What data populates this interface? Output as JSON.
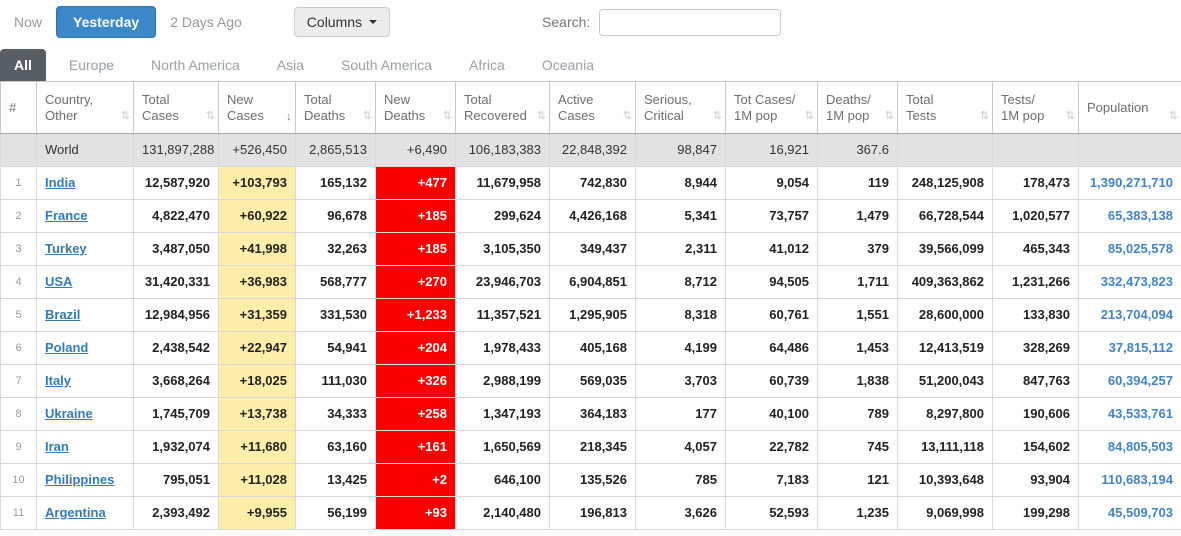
{
  "toolbar": {
    "now_label": "Now",
    "yesterday_label": "Yesterday",
    "two_days_ago_label": "2 Days Ago",
    "columns_label": "Columns",
    "search_label": "Search:",
    "search_value": ""
  },
  "colors": {
    "active_button_blue": "#3b87c8",
    "active_tab_gray": "#565d63",
    "new_cases_yellow": "#FFEEAA",
    "new_deaths_red": "#fa0000",
    "world_row_gray": "#e2e2e2",
    "link_blue": "#337ab7"
  },
  "icons": {
    "sort_both": "⇅",
    "sort_desc": "↓",
    "caret_down": "▾"
  },
  "tabs": [
    {
      "label": "All",
      "state": "active"
    },
    {
      "label": "Europe",
      "state": ""
    },
    {
      "label": "North America",
      "state": ""
    },
    {
      "label": "Asia",
      "state": ""
    },
    {
      "label": "South America",
      "state": ""
    },
    {
      "label": "Africa",
      "state": ""
    },
    {
      "label": "Oceania",
      "state": ""
    }
  ],
  "table": {
    "columns": [
      {
        "line1": "#",
        "line2": "",
        "sort": "none",
        "sort_icon": ""
      },
      {
        "line1": "Country,",
        "line2": "Other",
        "sort": "both",
        "sort_icon": "⇅"
      },
      {
        "line1": "Total",
        "line2": "Cases",
        "sort": "both",
        "sort_icon": "⇅"
      },
      {
        "line1": "New",
        "line2": "Cases",
        "sort": "desc",
        "sort_icon": "↓"
      },
      {
        "line1": "Total",
        "line2": "Deaths",
        "sort": "both",
        "sort_icon": "⇅"
      },
      {
        "line1": "New",
        "line2": "Deaths",
        "sort": "both",
        "sort_icon": "⇅"
      },
      {
        "line1": "Total",
        "line2": "Recovered",
        "sort": "both",
        "sort_icon": "⇅"
      },
      {
        "line1": "Active",
        "line2": "Cases",
        "sort": "both",
        "sort_icon": "⇅"
      },
      {
        "line1": "Serious,",
        "line2": "Critical",
        "sort": "both",
        "sort_icon": "⇅"
      },
      {
        "line1": "Tot Cases/",
        "line2": "1M pop",
        "sort": "both",
        "sort_icon": "⇅"
      },
      {
        "line1": "Deaths/",
        "line2": "1M pop",
        "sort": "both",
        "sort_icon": "⇅"
      },
      {
        "line1": "Total",
        "line2": "Tests",
        "sort": "both",
        "sort_icon": "⇅"
      },
      {
        "line1": "Tests/",
        "line2": "1M pop",
        "sort": "both",
        "sort_icon": "⇅"
      },
      {
        "line1": "Population",
        "line2": "",
        "sort": "both",
        "sort_icon": "⇅"
      }
    ],
    "world": {
      "name": "World",
      "total_cases": "131,897,288",
      "new_cases": "+526,450",
      "total_deaths": "2,865,513",
      "new_deaths": "+6,490",
      "total_recovered": "106,183,383",
      "active_cases": "22,848,392",
      "serious_critical": "98,847",
      "cases_per_1m": "16,921",
      "deaths_per_1m": "367.6",
      "total_tests": "",
      "tests_per_1m": "",
      "population": ""
    },
    "rows": [
      {
        "rank": "1",
        "country": "India",
        "total_cases": "12,587,920",
        "new_cases": "+103,793",
        "total_deaths": "165,132",
        "new_deaths": "+477",
        "total_recovered": "11,679,958",
        "active_cases": "742,830",
        "serious_critical": "8,944",
        "cases_per_1m": "9,054",
        "deaths_per_1m": "119",
        "total_tests": "248,125,908",
        "tests_per_1m": "178,473",
        "population": "1,390,271,710"
      },
      {
        "rank": "2",
        "country": "France",
        "total_cases": "4,822,470",
        "new_cases": "+60,922",
        "total_deaths": "96,678",
        "new_deaths": "+185",
        "total_recovered": "299,624",
        "active_cases": "4,426,168",
        "serious_critical": "5,341",
        "cases_per_1m": "73,757",
        "deaths_per_1m": "1,479",
        "total_tests": "66,728,544",
        "tests_per_1m": "1,020,577",
        "population": "65,383,138"
      },
      {
        "rank": "3",
        "country": "Turkey",
        "total_cases": "3,487,050",
        "new_cases": "+41,998",
        "total_deaths": "32,263",
        "new_deaths": "+185",
        "total_recovered": "3,105,350",
        "active_cases": "349,437",
        "serious_critical": "2,311",
        "cases_per_1m": "41,012",
        "deaths_per_1m": "379",
        "total_tests": "39,566,099",
        "tests_per_1m": "465,343",
        "population": "85,025,578"
      },
      {
        "rank": "4",
        "country": "USA",
        "total_cases": "31,420,331",
        "new_cases": "+36,983",
        "total_deaths": "568,777",
        "new_deaths": "+270",
        "total_recovered": "23,946,703",
        "active_cases": "6,904,851",
        "serious_critical": "8,712",
        "cases_per_1m": "94,505",
        "deaths_per_1m": "1,711",
        "total_tests": "409,363,862",
        "tests_per_1m": "1,231,266",
        "population": "332,473,823"
      },
      {
        "rank": "5",
        "country": "Brazil",
        "total_cases": "12,984,956",
        "new_cases": "+31,359",
        "total_deaths": "331,530",
        "new_deaths": "+1,233",
        "total_recovered": "11,357,521",
        "active_cases": "1,295,905",
        "serious_critical": "8,318",
        "cases_per_1m": "60,761",
        "deaths_per_1m": "1,551",
        "total_tests": "28,600,000",
        "tests_per_1m": "133,830",
        "population": "213,704,094"
      },
      {
        "rank": "6",
        "country": "Poland",
        "total_cases": "2,438,542",
        "new_cases": "+22,947",
        "total_deaths": "54,941",
        "new_deaths": "+204",
        "total_recovered": "1,978,433",
        "active_cases": "405,168",
        "serious_critical": "4,199",
        "cases_per_1m": "64,486",
        "deaths_per_1m": "1,453",
        "total_tests": "12,413,519",
        "tests_per_1m": "328,269",
        "population": "37,815,112"
      },
      {
        "rank": "7",
        "country": "Italy",
        "total_cases": "3,668,264",
        "new_cases": "+18,025",
        "total_deaths": "111,030",
        "new_deaths": "+326",
        "total_recovered": "2,988,199",
        "active_cases": "569,035",
        "serious_critical": "3,703",
        "cases_per_1m": "60,739",
        "deaths_per_1m": "1,838",
        "total_tests": "51,200,043",
        "tests_per_1m": "847,763",
        "population": "60,394,257"
      },
      {
        "rank": "8",
        "country": "Ukraine",
        "total_cases": "1,745,709",
        "new_cases": "+13,738",
        "total_deaths": "34,333",
        "new_deaths": "+258",
        "total_recovered": "1,347,193",
        "active_cases": "364,183",
        "serious_critical": "177",
        "cases_per_1m": "40,100",
        "deaths_per_1m": "789",
        "total_tests": "8,297,800",
        "tests_per_1m": "190,606",
        "population": "43,533,761"
      },
      {
        "rank": "9",
        "country": "Iran",
        "total_cases": "1,932,074",
        "new_cases": "+11,680",
        "total_deaths": "63,160",
        "new_deaths": "+161",
        "total_recovered": "1,650,569",
        "active_cases": "218,345",
        "serious_critical": "4,057",
        "cases_per_1m": "22,782",
        "deaths_per_1m": "745",
        "total_tests": "13,111,118",
        "tests_per_1m": "154,602",
        "population": "84,805,503"
      },
      {
        "rank": "10",
        "country": "Philippines",
        "total_cases": "795,051",
        "new_cases": "+11,028",
        "total_deaths": "13,425",
        "new_deaths": "+2",
        "total_recovered": "646,100",
        "active_cases": "135,526",
        "serious_critical": "785",
        "cases_per_1m": "7,183",
        "deaths_per_1m": "121",
        "total_tests": "10,393,648",
        "tests_per_1m": "93,904",
        "population": "110,683,194"
      },
      {
        "rank": "11",
        "country": "Argentina",
        "total_cases": "2,393,492",
        "new_cases": "+9,955",
        "total_deaths": "56,199",
        "new_deaths": "+93",
        "total_recovered": "2,140,480",
        "active_cases": "196,813",
        "serious_critical": "3,626",
        "cases_per_1m": "52,593",
        "deaths_per_1m": "1,235",
        "total_tests": "9,069,998",
        "tests_per_1m": "199,298",
        "population": "45,509,703"
      }
    ]
  }
}
